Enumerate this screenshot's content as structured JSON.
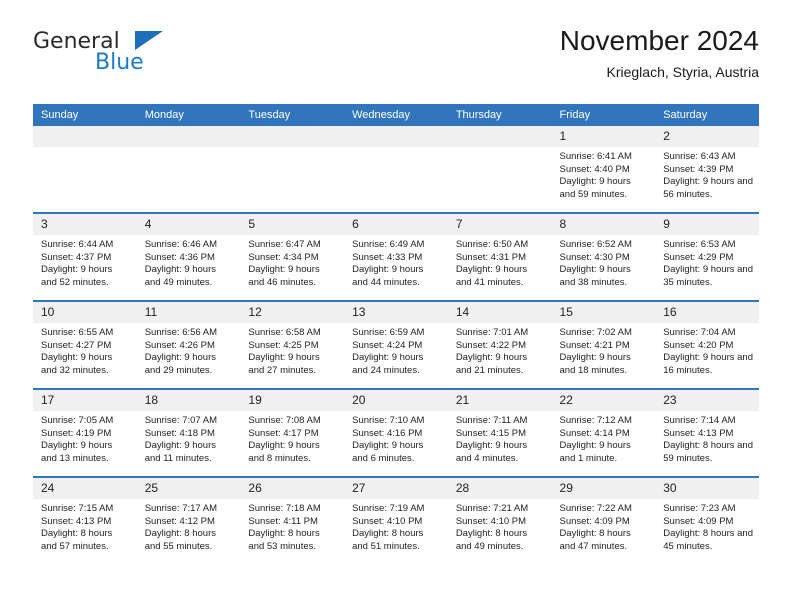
{
  "brand": {
    "name_part1": "General",
    "name_part2": "Blue",
    "logo_icon": "blue-triangle-icon"
  },
  "header": {
    "title": "November 2024",
    "location": "Krieglach, Styria, Austria"
  },
  "calendar": {
    "weekday_headers": [
      "Sunday",
      "Monday",
      "Tuesday",
      "Wednesday",
      "Thursday",
      "Friday",
      "Saturday"
    ],
    "accent_color": "#3176bd",
    "daynum_background": "#f0f0f0",
    "weeks": [
      [
        {
          "day": "",
          "empty": true
        },
        {
          "day": "",
          "empty": true
        },
        {
          "day": "",
          "empty": true
        },
        {
          "day": "",
          "empty": true
        },
        {
          "day": "",
          "empty": true
        },
        {
          "day": "1",
          "sunrise": "Sunrise: 6:41 AM",
          "sunset": "Sunset: 4:40 PM",
          "daylight": "Daylight: 9 hours and 59 minutes."
        },
        {
          "day": "2",
          "sunrise": "Sunrise: 6:43 AM",
          "sunset": "Sunset: 4:39 PM",
          "daylight": "Daylight: 9 hours and 56 minutes."
        }
      ],
      [
        {
          "day": "3",
          "sunrise": "Sunrise: 6:44 AM",
          "sunset": "Sunset: 4:37 PM",
          "daylight": "Daylight: 9 hours and 52 minutes."
        },
        {
          "day": "4",
          "sunrise": "Sunrise: 6:46 AM",
          "sunset": "Sunset: 4:36 PM",
          "daylight": "Daylight: 9 hours and 49 minutes."
        },
        {
          "day": "5",
          "sunrise": "Sunrise: 6:47 AM",
          "sunset": "Sunset: 4:34 PM",
          "daylight": "Daylight: 9 hours and 46 minutes."
        },
        {
          "day": "6",
          "sunrise": "Sunrise: 6:49 AM",
          "sunset": "Sunset: 4:33 PM",
          "daylight": "Daylight: 9 hours and 44 minutes."
        },
        {
          "day": "7",
          "sunrise": "Sunrise: 6:50 AM",
          "sunset": "Sunset: 4:31 PM",
          "daylight": "Daylight: 9 hours and 41 minutes."
        },
        {
          "day": "8",
          "sunrise": "Sunrise: 6:52 AM",
          "sunset": "Sunset: 4:30 PM",
          "daylight": "Daylight: 9 hours and 38 minutes."
        },
        {
          "day": "9",
          "sunrise": "Sunrise: 6:53 AM",
          "sunset": "Sunset: 4:29 PM",
          "daylight": "Daylight: 9 hours and 35 minutes."
        }
      ],
      [
        {
          "day": "10",
          "sunrise": "Sunrise: 6:55 AM",
          "sunset": "Sunset: 4:27 PM",
          "daylight": "Daylight: 9 hours and 32 minutes."
        },
        {
          "day": "11",
          "sunrise": "Sunrise: 6:56 AM",
          "sunset": "Sunset: 4:26 PM",
          "daylight": "Daylight: 9 hours and 29 minutes."
        },
        {
          "day": "12",
          "sunrise": "Sunrise: 6:58 AM",
          "sunset": "Sunset: 4:25 PM",
          "daylight": "Daylight: 9 hours and 27 minutes."
        },
        {
          "day": "13",
          "sunrise": "Sunrise: 6:59 AM",
          "sunset": "Sunset: 4:24 PM",
          "daylight": "Daylight: 9 hours and 24 minutes."
        },
        {
          "day": "14",
          "sunrise": "Sunrise: 7:01 AM",
          "sunset": "Sunset: 4:22 PM",
          "daylight": "Daylight: 9 hours and 21 minutes."
        },
        {
          "day": "15",
          "sunrise": "Sunrise: 7:02 AM",
          "sunset": "Sunset: 4:21 PM",
          "daylight": "Daylight: 9 hours and 18 minutes."
        },
        {
          "day": "16",
          "sunrise": "Sunrise: 7:04 AM",
          "sunset": "Sunset: 4:20 PM",
          "daylight": "Daylight: 9 hours and 16 minutes."
        }
      ],
      [
        {
          "day": "17",
          "sunrise": "Sunrise: 7:05 AM",
          "sunset": "Sunset: 4:19 PM",
          "daylight": "Daylight: 9 hours and 13 minutes."
        },
        {
          "day": "18",
          "sunrise": "Sunrise: 7:07 AM",
          "sunset": "Sunset: 4:18 PM",
          "daylight": "Daylight: 9 hours and 11 minutes."
        },
        {
          "day": "19",
          "sunrise": "Sunrise: 7:08 AM",
          "sunset": "Sunset: 4:17 PM",
          "daylight": "Daylight: 9 hours and 8 minutes."
        },
        {
          "day": "20",
          "sunrise": "Sunrise: 7:10 AM",
          "sunset": "Sunset: 4:16 PM",
          "daylight": "Daylight: 9 hours and 6 minutes."
        },
        {
          "day": "21",
          "sunrise": "Sunrise: 7:11 AM",
          "sunset": "Sunset: 4:15 PM",
          "daylight": "Daylight: 9 hours and 4 minutes."
        },
        {
          "day": "22",
          "sunrise": "Sunrise: 7:12 AM",
          "sunset": "Sunset: 4:14 PM",
          "daylight": "Daylight: 9 hours and 1 minute."
        },
        {
          "day": "23",
          "sunrise": "Sunrise: 7:14 AM",
          "sunset": "Sunset: 4:13 PM",
          "daylight": "Daylight: 8 hours and 59 minutes."
        }
      ],
      [
        {
          "day": "24",
          "sunrise": "Sunrise: 7:15 AM",
          "sunset": "Sunset: 4:13 PM",
          "daylight": "Daylight: 8 hours and 57 minutes."
        },
        {
          "day": "25",
          "sunrise": "Sunrise: 7:17 AM",
          "sunset": "Sunset: 4:12 PM",
          "daylight": "Daylight: 8 hours and 55 minutes."
        },
        {
          "day": "26",
          "sunrise": "Sunrise: 7:18 AM",
          "sunset": "Sunset: 4:11 PM",
          "daylight": "Daylight: 8 hours and 53 minutes."
        },
        {
          "day": "27",
          "sunrise": "Sunrise: 7:19 AM",
          "sunset": "Sunset: 4:10 PM",
          "daylight": "Daylight: 8 hours and 51 minutes."
        },
        {
          "day": "28",
          "sunrise": "Sunrise: 7:21 AM",
          "sunset": "Sunset: 4:10 PM",
          "daylight": "Daylight: 8 hours and 49 minutes."
        },
        {
          "day": "29",
          "sunrise": "Sunrise: 7:22 AM",
          "sunset": "Sunset: 4:09 PM",
          "daylight": "Daylight: 8 hours and 47 minutes."
        },
        {
          "day": "30",
          "sunrise": "Sunrise: 7:23 AM",
          "sunset": "Sunset: 4:09 PM",
          "daylight": "Daylight: 8 hours and 45 minutes."
        }
      ]
    ]
  }
}
